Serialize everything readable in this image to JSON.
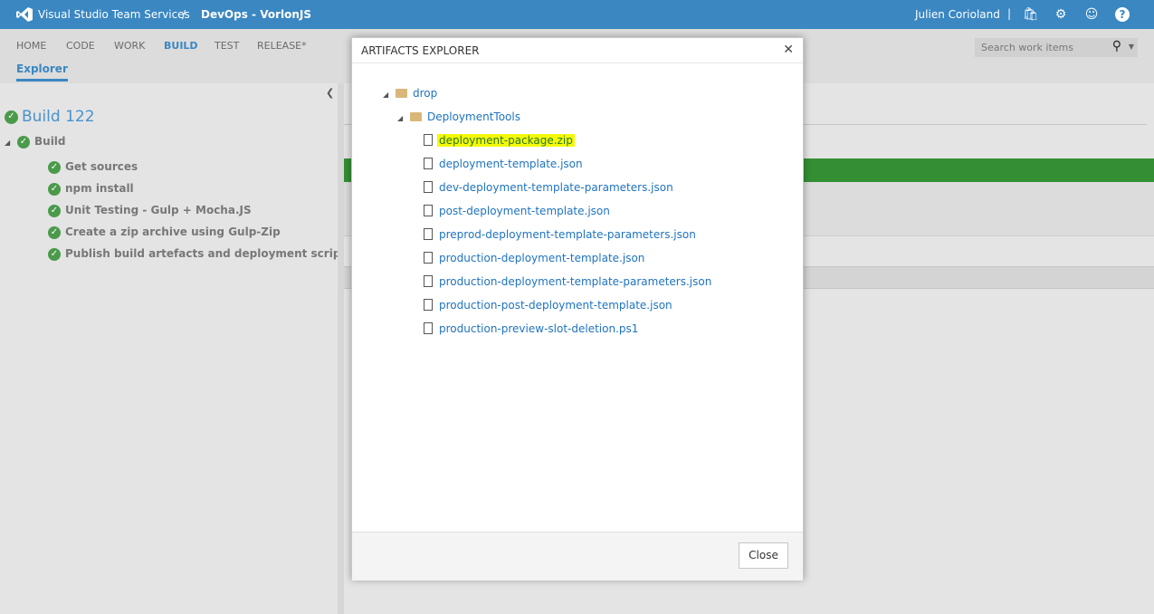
{
  "topbar": {
    "product": "Visual Studio Team Services",
    "separator": "/",
    "project": "DevOps - VorlonJS",
    "user": "Julien Corioland",
    "divider": "|",
    "icons": [
      "shopping-bag-icon",
      "gear-icon",
      "smiley-icon",
      "help-icon"
    ]
  },
  "nav": {
    "items": [
      "HOME",
      "CODE",
      "WORK",
      "BUILD",
      "TEST",
      "RELEASE*"
    ],
    "active": "BUILD",
    "sub": "Explorer",
    "search_placeholder": "Search work items"
  },
  "build": {
    "title": "Build 122",
    "node": "Build",
    "steps": [
      "Get sources",
      "npm install",
      "Unit Testing - Gulp + Mocha.JS",
      "Create a zip archive using Gulp-Zip",
      "Publish build artefacts and deployment scripts"
    ],
    "status_color": "#4a9a4a"
  },
  "modal": {
    "title": "ARTIFACTS EXPLORER",
    "close_label": "Close",
    "root": "drop",
    "folder": "DeploymentTools",
    "files": [
      "deployment-package.zip",
      "deployment-template.json",
      "dev-deployment-template-parameters.json",
      "post-deployment-template.json",
      "preprod-deployment-template-parameters.json",
      "production-deployment-template.json",
      "production-deployment-template-parameters.json",
      "production-post-deployment-template.json",
      "production-preview-slot-deletion.ps1"
    ],
    "highlighted": "deployment-package.zip",
    "highlight_color": "#f4f90a"
  },
  "colors": {
    "brand": "#3a87c2",
    "success": "#348f34"
  }
}
